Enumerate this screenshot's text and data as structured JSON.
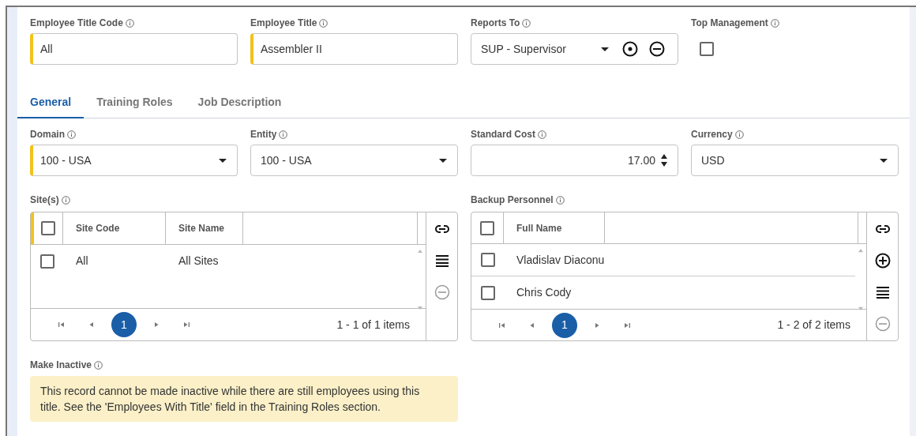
{
  "top_fields": [
    {
      "label": "Employee Title Code",
      "kind": "text",
      "value": "All",
      "required": true
    },
    {
      "label": "Employee Title",
      "kind": "text",
      "value": "Assembler II",
      "required": true
    },
    {
      "label": "Reports To",
      "kind": "lookup",
      "value": "SUP - Supervisor",
      "required": false
    },
    {
      "label": "Top Management",
      "kind": "checkbox",
      "checked": false
    }
  ],
  "tabs": [
    {
      "label": "General",
      "selected": true
    },
    {
      "label": "Training Roles",
      "selected": false
    },
    {
      "label": "Job Description",
      "selected": false
    }
  ],
  "general_fields": [
    {
      "label": "Domain",
      "kind": "select",
      "value": "100 - USA",
      "required": true
    },
    {
      "label": "Entity",
      "kind": "select",
      "value": "100 - USA",
      "required": false
    },
    {
      "label": "Standard Cost",
      "kind": "number",
      "value": "17.00",
      "required": false
    },
    {
      "label": "Currency",
      "kind": "select",
      "value": "USD",
      "required": false
    }
  ],
  "grids": [
    {
      "label": "Site(s)",
      "required": true,
      "header_checked": false,
      "columns": [
        "Site Code",
        "Site Name"
      ],
      "rows": [
        {
          "cells": [
            "All",
            "All Sites"
          ],
          "checked": false
        }
      ],
      "pages": [
        {
          "label": "1",
          "selected": true
        }
      ],
      "summary": "1 - 1 of 1 items",
      "tools": [
        {
          "kind": "link",
          "disabled": false
        },
        {
          "kind": "list",
          "disabled": false
        },
        {
          "kind": "remove",
          "disabled": true
        }
      ]
    },
    {
      "label": "Backup Personnel",
      "required": false,
      "header_checked": false,
      "columns": [
        "Full Name"
      ],
      "rows": [
        {
          "cells": [
            "Vladislav Diaconu"
          ],
          "checked": false
        },
        {
          "cells": [
            "Chris Cody"
          ],
          "checked": false
        }
      ],
      "pages": [
        {
          "label": "1",
          "selected": true
        }
      ],
      "summary": "1 - 2 of 2 items",
      "tools": [
        {
          "kind": "link",
          "disabled": false
        },
        {
          "kind": "add",
          "disabled": false
        },
        {
          "kind": "list",
          "disabled": false
        },
        {
          "kind": "remove",
          "disabled": true
        }
      ]
    }
  ],
  "make_inactive": {
    "label": "Make Inactive",
    "message": "This record cannot be made inactive while there are still employees using this title. See the 'Employees With Title' field in the Training Roles section."
  }
}
